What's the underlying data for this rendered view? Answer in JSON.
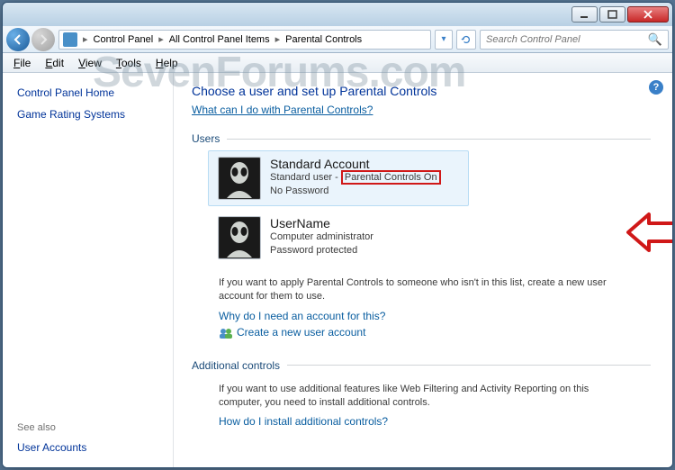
{
  "titlebar": {
    "min": "minimize",
    "max": "maximize",
    "close": "close"
  },
  "breadcrumb": {
    "items": [
      "Control Panel",
      "All Control Panel Items",
      "Parental Controls"
    ]
  },
  "search": {
    "placeholder": "Search Control Panel"
  },
  "menu": {
    "file": "File",
    "edit": "Edit",
    "view": "View",
    "tools": "Tools",
    "help": "Help"
  },
  "sidebar": {
    "home": "Control Panel Home",
    "rating": "Game Rating Systems",
    "seealso_label": "See also",
    "useraccounts": "User Accounts"
  },
  "main": {
    "heading": "Choose a user and set up Parental Controls",
    "whatcan": "What can I do with Parental Controls?",
    "users_legend": "Users",
    "users": [
      {
        "name": "Standard Account",
        "type": "Standard user",
        "pc_status": "Parental Controls On",
        "pw": "No Password",
        "selected": true
      },
      {
        "name": "UserName",
        "type": "Computer administrator",
        "pc_status": "",
        "pw": "Password protected",
        "selected": false
      }
    ],
    "applytext": "If you want to apply Parental Controls to someone who isn't in this list, create a new user account for them to use.",
    "whyneed": "Why do I need an account for this?",
    "createnew": "Create a new user account",
    "additional_legend": "Additional controls",
    "additionaltext": "If you want to use additional features like Web Filtering and Activity Reporting on this computer, you need to install additional controls.",
    "howinstall": "How do I install additional controls?"
  },
  "watermark": "SevenForums.com"
}
